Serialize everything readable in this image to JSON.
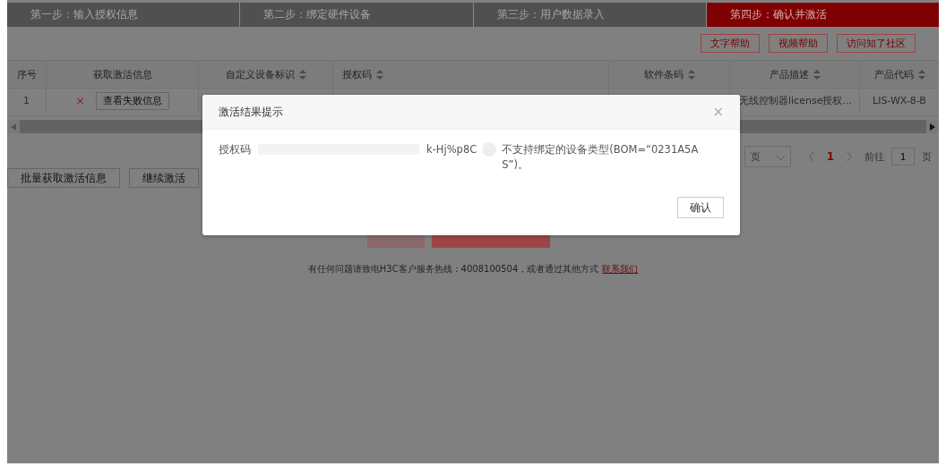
{
  "steps": [
    {
      "label": "第一步：输入授权信息",
      "selected": false
    },
    {
      "label": "第二步：绑定硬件设备",
      "selected": false
    },
    {
      "label": "第三步：用户数据录入",
      "selected": false
    },
    {
      "label": "第四步：确认并激活",
      "selected": true
    }
  ],
  "help_buttons": [
    "文字帮助",
    "视频帮助",
    "访问知了社区"
  ],
  "table": {
    "columns": [
      {
        "label": "序号",
        "sortable": false
      },
      {
        "label": "获取激活信息",
        "sortable": false
      },
      {
        "label": "自定义设备标识",
        "sortable": true
      },
      {
        "label": "授权码",
        "sortable": true
      },
      {
        "label": "软件条码",
        "sortable": true
      },
      {
        "label": "产品描述",
        "sortable": true
      },
      {
        "label": "产品代码",
        "sortable": true
      }
    ],
    "rows": [
      {
        "index": "1",
        "status": "×",
        "action": "查看失败信息",
        "description": "无线控制器license授权...",
        "code": "LIS-WX-8-B"
      }
    ]
  },
  "pagination": {
    "page_size_suffix": "页",
    "current_page": "1",
    "goto_label": "前往",
    "goto_value": "1",
    "goto_suffix": "页"
  },
  "batch_buttons": [
    "批量获取激活信息",
    "继续激活"
  ],
  "footer": {
    "text": "有任何问题请致电H3C客户服务热线：4008100504，或者通过其他方式",
    "link": "联系我们"
  },
  "dialog": {
    "title": "激活结果提示",
    "close": "×",
    "message_label": "授权码",
    "message_code_tail": "k-Hj%p8C",
    "message_text": "不支持绑定的设备类型(BOM=“0231A5AS”)。",
    "confirm": "确认"
  }
}
